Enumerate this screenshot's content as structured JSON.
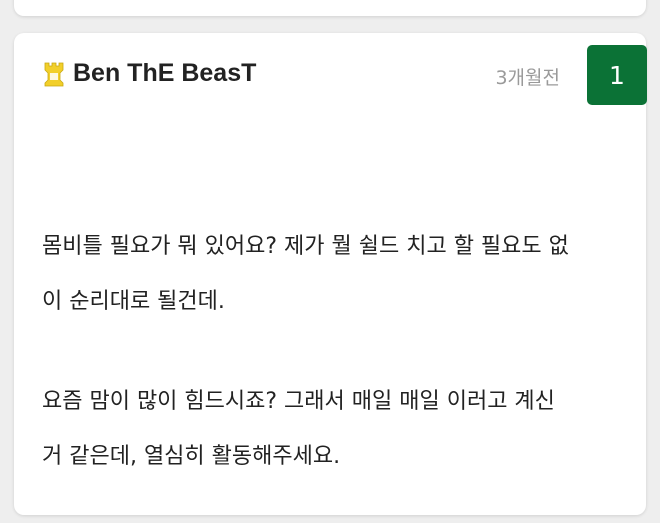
{
  "comment": {
    "author": "Ben ThE BeasT",
    "timestamp": "3개월전",
    "vote_count": "1",
    "rank_icon": "chess-rook-icon",
    "paragraphs": [
      "몸비틀 필요가 뭐 있어요? 제가 뭘 쉴드 치고 할 필요도 없\n이 순리대로 될건데.",
      "요즘 맘이 많이 힘드시죠? 그래서 매일 매일 이러고 계신\n거 같은데, 열심히 활동해주세요."
    ]
  },
  "colors": {
    "vote_badge_bg": "#0b7236",
    "rank_icon": "#f2cf2a",
    "timestamp": "#9a9a9a"
  }
}
